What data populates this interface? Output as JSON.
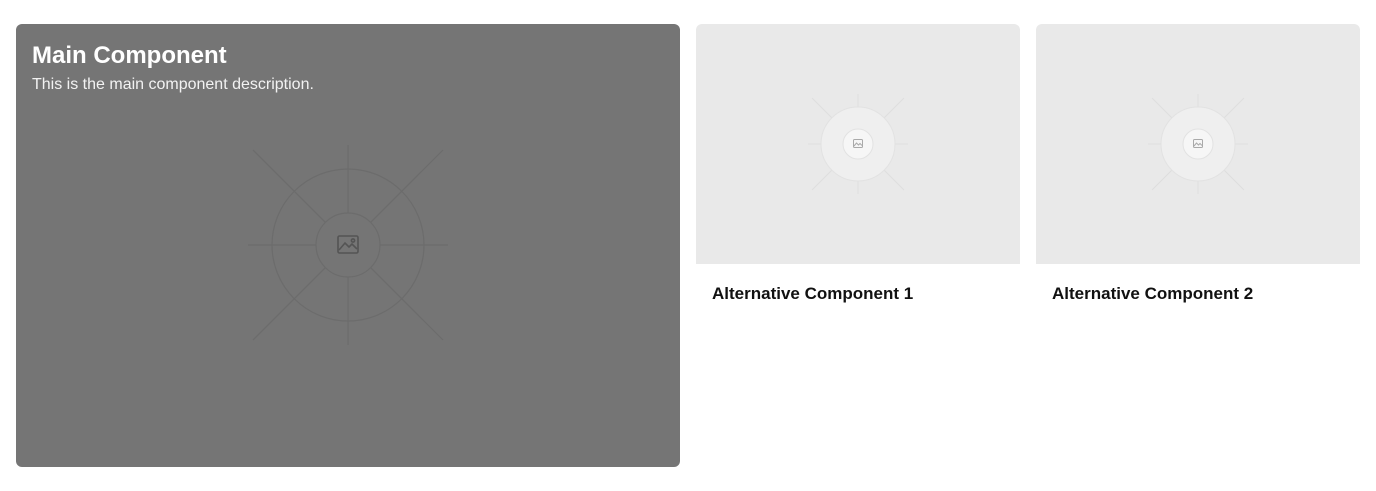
{
  "main_component": {
    "title": "Main Component",
    "description": "This is the main component description.",
    "image_icon": "image-placeholder-icon",
    "background_color": "#757575"
  },
  "alternatives": [
    {
      "title": "Alternative Component 1",
      "image_icon": "image-placeholder-icon"
    },
    {
      "title": "Alternative Component 2",
      "image_icon": "image-placeholder-icon"
    }
  ],
  "colors": {
    "placeholder_light": "#e9e9e9",
    "title_text": "#111111"
  }
}
